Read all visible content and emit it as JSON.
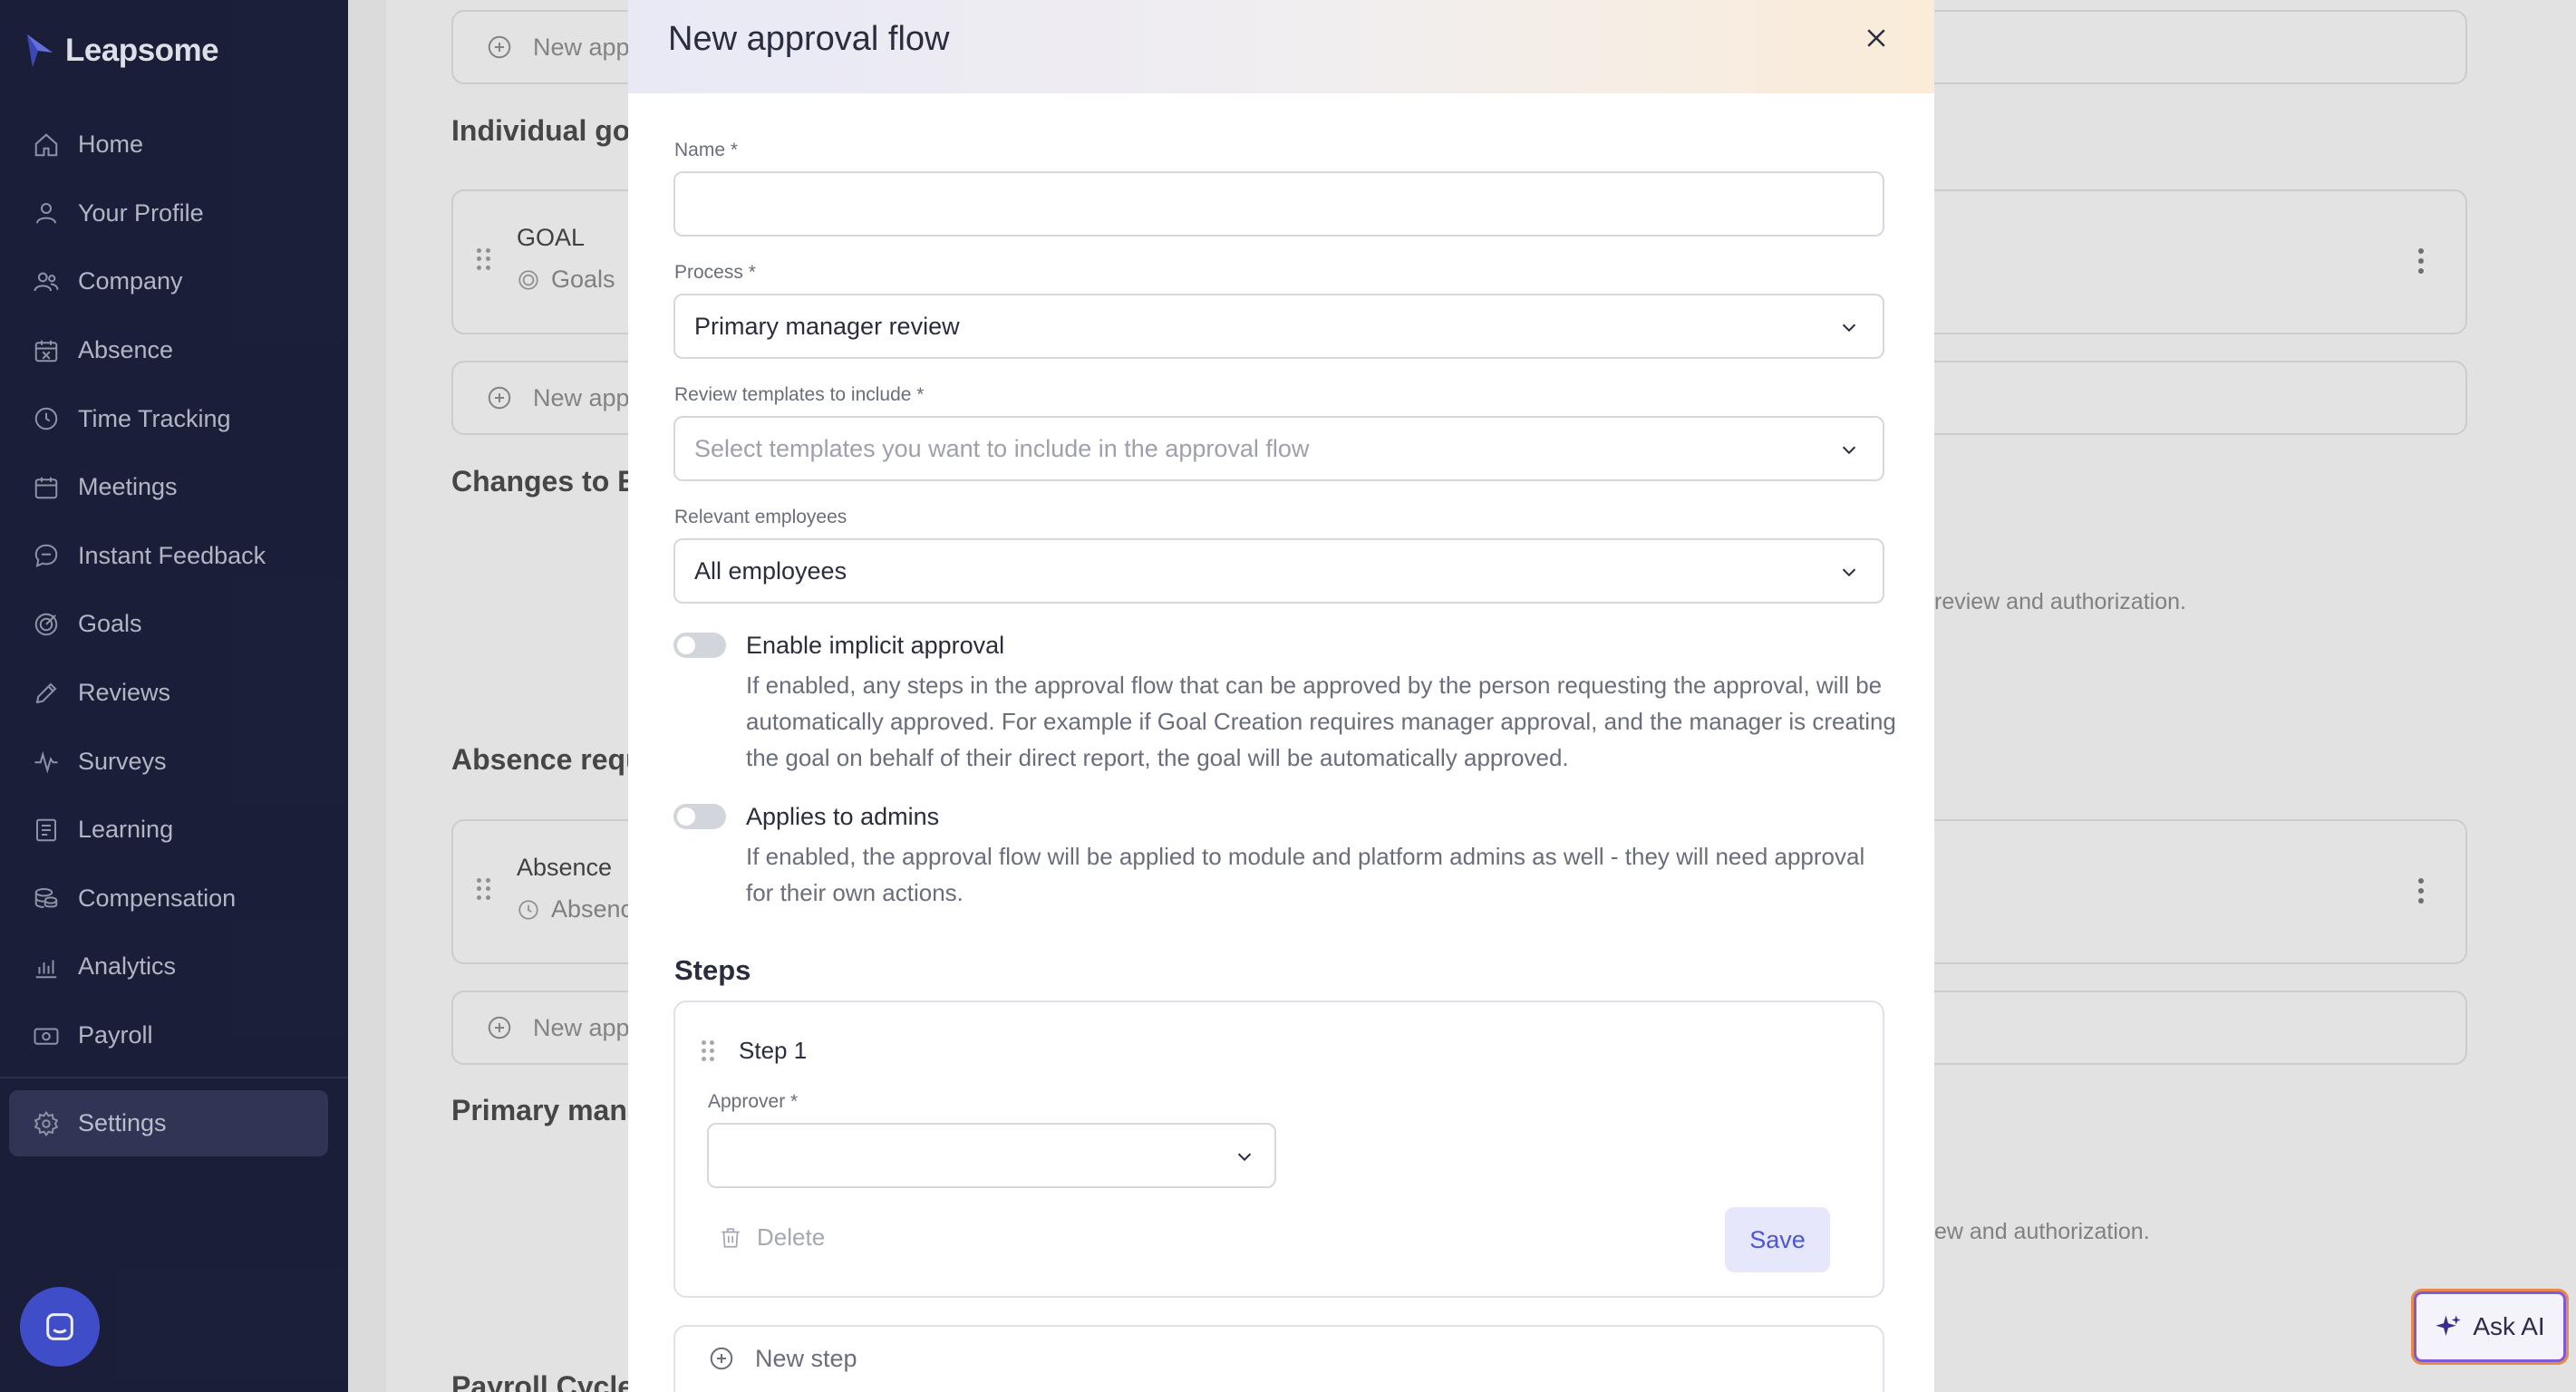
{
  "app": {
    "brand": "Leapsome"
  },
  "sidebar": {
    "items": [
      {
        "label": "Home",
        "icon": "home-icon"
      },
      {
        "label": "Your Profile",
        "icon": "user-icon"
      },
      {
        "label": "Company",
        "icon": "users-icon"
      },
      {
        "label": "Absence",
        "icon": "calendar-x-icon"
      },
      {
        "label": "Time Tracking",
        "icon": "clock-icon"
      },
      {
        "label": "Meetings",
        "icon": "calendar-icon"
      },
      {
        "label": "Instant Feedback",
        "icon": "chat-icon"
      },
      {
        "label": "Goals",
        "icon": "target-icon"
      },
      {
        "label": "Reviews",
        "icon": "pencil-icon"
      },
      {
        "label": "Surveys",
        "icon": "pulse-icon"
      },
      {
        "label": "Learning",
        "icon": "book-icon"
      },
      {
        "label": "Compensation",
        "icon": "coins-icon"
      },
      {
        "label": "Analytics",
        "icon": "chart-icon"
      },
      {
        "label": "Payroll",
        "icon": "money-icon"
      }
    ],
    "settings_label": "Settings"
  },
  "background": {
    "new_approval_label": "New app",
    "individual_goals_heading": "Individual goa",
    "goal_title": "GOAL",
    "goal_sub": "Goals",
    "changes_heading": "Changes to E",
    "review_text_1": "review and authorization.",
    "absence_heading": "Absence requ",
    "absence_title": "Absence",
    "absence_sub": "Absenc",
    "primary_heading": "Primary mana",
    "review_text_2": "ew and authorization.",
    "payroll_heading": "Payroll Cycle"
  },
  "ask_ai": {
    "label": "Ask AI"
  },
  "modal": {
    "title": "New approval flow",
    "name": {
      "label": "Name *",
      "value": ""
    },
    "process": {
      "label": "Process *",
      "value": "Primary manager review"
    },
    "templates": {
      "label": "Review templates to include *",
      "placeholder": "Select templates you want to include in the approval flow"
    },
    "employees": {
      "label": "Relevant employees",
      "value": "All employees"
    },
    "implicit": {
      "label": "Enable implicit approval",
      "enabled": false,
      "description": "If enabled, any steps in the approval flow that can be approved by the person requesting the approval, will be automatically approved. For example if Goal Creation requires manager approval, and the manager is creating the goal on behalf of their direct report, the goal will be automatically approved."
    },
    "admins": {
      "label": "Applies to admins",
      "enabled": false,
      "description": "If enabled, the approval flow will be applied to module and platform admins as well - they will need approval for their own actions."
    },
    "steps_title": "Steps",
    "step": {
      "title": "Step 1",
      "approver_label": "Approver *",
      "approver_value": "",
      "delete_label": "Delete",
      "save_label": "Save"
    },
    "new_step_label": "New step"
  },
  "colors": {
    "sidebar_bg": "#1b1f3b",
    "accent": "#4a56d6",
    "settings_active_bg": "#32375a"
  }
}
